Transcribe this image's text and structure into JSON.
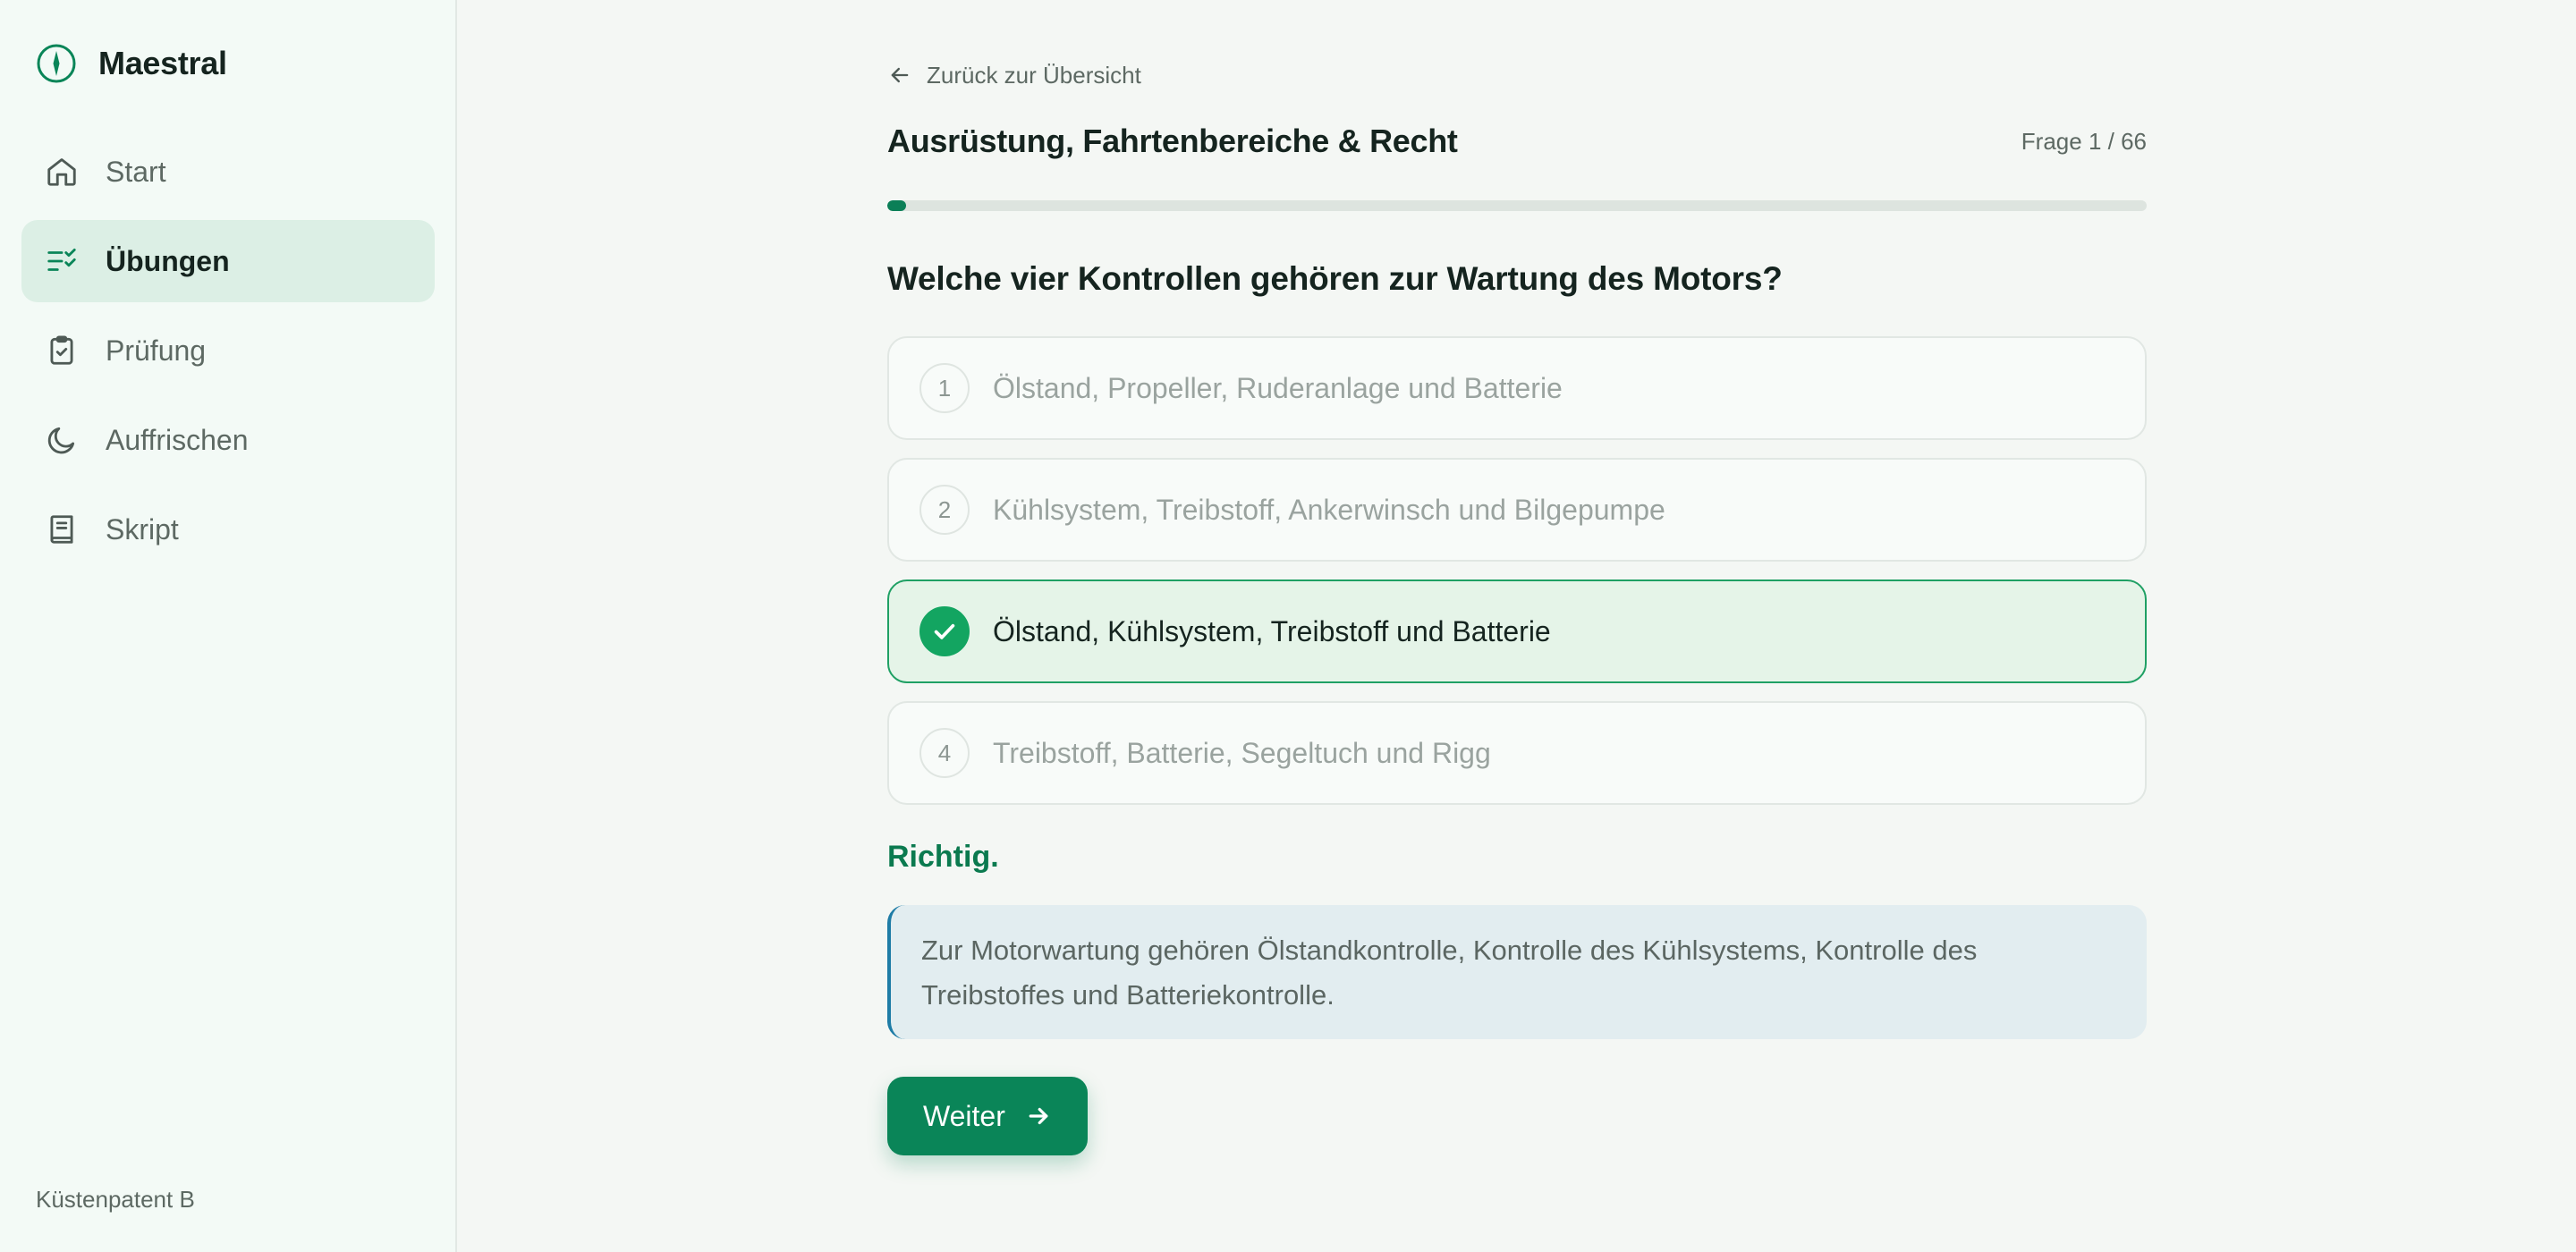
{
  "sidebar": {
    "brand": "Maestral",
    "items": [
      {
        "label": "Start",
        "icon": "home-icon",
        "active": false
      },
      {
        "label": "Übungen",
        "icon": "checklist-icon",
        "active": true
      },
      {
        "label": "Prüfung",
        "icon": "clipboard-check-icon",
        "active": false
      },
      {
        "label": "Auffrischen",
        "icon": "moon-icon",
        "active": false
      },
      {
        "label": "Skript",
        "icon": "book-icon",
        "active": false
      }
    ],
    "footer": "Küstenpatent B"
  },
  "main": {
    "back_label": "Zurück zur Übersicht",
    "title": "Ausrüstung, Fahrtenbereiche & Recht",
    "counter": "Frage 1 / 66",
    "progress": {
      "current": 1,
      "total": 66
    },
    "question": "Welche vier Kontrollen gehören zur Wartung des Motors?",
    "answers": [
      {
        "number": "1",
        "text": "Ölstand, Propeller, Ruderanlage und Batterie",
        "state": "default"
      },
      {
        "number": "2",
        "text": "Kühlsystem, Treibstoff, Ankerwinsch und Bilgepumpe",
        "state": "default"
      },
      {
        "number": "3",
        "text": "Ölstand, Kühlsystem, Treibstoff und Batterie",
        "state": "correct"
      },
      {
        "number": "4",
        "text": "Treibstoff, Batterie, Segeltuch und Rigg",
        "state": "default"
      }
    ],
    "result": "Richtig.",
    "explanation": "Zur Motorwartung gehören Ölstandkontrolle, Kontrolle des Kühlsystems, Kontrolle des Treibstoffes und Batteriekontrolle.",
    "next_label": "Weiter"
  },
  "colors": {
    "accent": "#0a8558",
    "correct_bg": "#e5f4e8",
    "correct_border": "#1fa064",
    "explanation_bg": "#e2edf0",
    "explanation_border": "#1e7ca6",
    "sidebar_active_bg": "#dcefe5"
  }
}
